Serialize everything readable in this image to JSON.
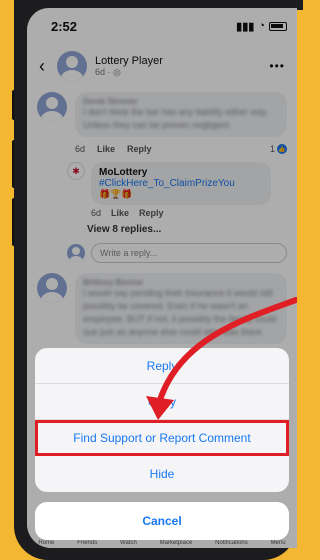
{
  "status": {
    "time": "2:52"
  },
  "post_header": {
    "name": "Lottery Player",
    "meta": "6d · ◎"
  },
  "comment1": {
    "author": "Derek Streeter",
    "text": "I don't think the bar has any liability either way. Unless they can be proven negligent.",
    "time": "6d",
    "like": "Like",
    "reply": "Reply",
    "like_count": "1"
  },
  "reply": {
    "name": "MoLottery",
    "link": "#ClickHere_To_ClaimPrizeYou",
    "emoji": "🎁🏆🎁",
    "time": "6d",
    "like": "Like",
    "reply": "Reply"
  },
  "view_replies": "View 8 replies...",
  "write_placeholder": "Write a reply...",
  "comment2": {
    "author": "Brittney Bonine",
    "text": "I would say pending their insurance it would still possibly be covered. Even if he wasn't an employee. BUT if not, it possibly the family could sue just as anyone else could who was there"
  },
  "sheet": {
    "items": [
      "Reply",
      "Copy",
      "Find Support or Report Comment",
      "Hide"
    ],
    "cancel": "Cancel"
  },
  "tabbar": [
    "Home",
    "Friends",
    "Watch",
    "Marketplace",
    "Notifications",
    "Menu"
  ],
  "colors": {
    "accent": "#1877f2",
    "highlight": "#e01e26",
    "background": "#f4b731"
  }
}
